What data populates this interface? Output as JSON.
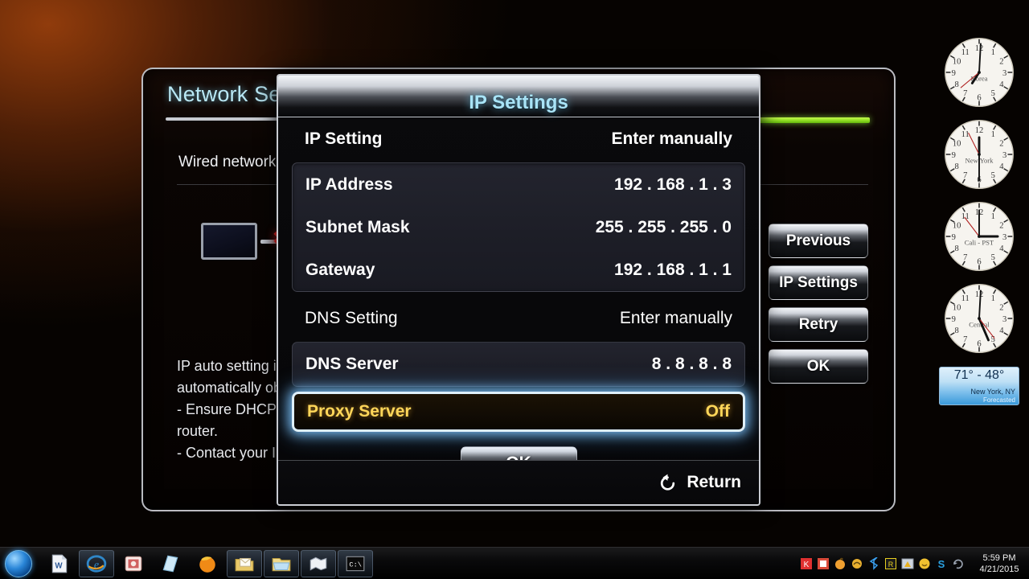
{
  "background_panel": {
    "title": "Network Settings",
    "wired_label": "Wired network connection",
    "help_lines": [
      "IP auto setting is configured",
      "automatically obtain IP values.",
      "- Ensure DHCP server is enabled on",
      "router.",
      "- Contact your Internet provider."
    ],
    "buttons": [
      {
        "label": "Previous",
        "name": "previous-button"
      },
      {
        "label": "IP Settings",
        "name": "ip-settings-button"
      },
      {
        "label": "Retry",
        "name": "retry-button"
      },
      {
        "label": "OK",
        "name": "ok-button-side"
      }
    ],
    "accent_green": "#8ede22",
    "title_color": "#b9e8f5"
  },
  "dialog": {
    "title": "IP Settings",
    "title_color": "#a9e4f7",
    "highlight_border": "#dff0fb",
    "highlight_text": "#ffd659",
    "rows": [
      {
        "label": "IP Setting",
        "value": "Enter manually",
        "group": "top",
        "weight": "bold"
      },
      {
        "label": "IP Address",
        "value": "192 . 168 . 1 . 3",
        "group": "ip",
        "weight": "bold"
      },
      {
        "label": "Subnet Mask",
        "value": "255 . 255 . 255 . 0",
        "group": "ip",
        "weight": "bold"
      },
      {
        "label": "Gateway",
        "value": "192 . 168 . 1 . 1",
        "group": "ip",
        "weight": "bold"
      },
      {
        "label": "DNS Setting",
        "value": "Enter manually",
        "group": "dns-setting",
        "weight": "light"
      },
      {
        "label": "DNS Server",
        "value": "8 . 8 . 8 . 8",
        "group": "dns",
        "weight": "bold"
      }
    ],
    "proxy_row": {
      "label": "Proxy Server",
      "value": "Off"
    },
    "ok_label": "OK",
    "return_label": "Return"
  },
  "gadgets": {
    "clocks": [
      {
        "label": "Korea",
        "hour": 6.3,
        "minute": 32,
        "second": 42
      },
      {
        "label": "New York",
        "hour": 5.99,
        "minute": 59,
        "second": 55
      },
      {
        "label": "Cali - PST",
        "hour": 2.99,
        "minute": 59,
        "second": 50
      },
      {
        "label": "Central",
        "hour": 4.9,
        "minute": 28,
        "second": 53
      }
    ],
    "weather": {
      "temperature": "71°  -  48°",
      "city": "New York, NY",
      "status": "Forecasted"
    }
  },
  "taskbar": {
    "start_name": "start-orb",
    "items": [
      {
        "name": "taskbar-word",
        "open": false
      },
      {
        "name": "taskbar-ie",
        "open": true
      },
      {
        "name": "taskbar-photos",
        "open": false
      },
      {
        "name": "taskbar-notepad",
        "open": false
      },
      {
        "name": "taskbar-firefox",
        "open": false
      },
      {
        "name": "taskbar-mail",
        "open": true
      },
      {
        "name": "taskbar-explorer",
        "open": true
      },
      {
        "name": "taskbar-map",
        "open": true
      },
      {
        "name": "taskbar-cmd",
        "open": true
      }
    ],
    "tray_icons": [
      "tray-antivirus-icon",
      "tray-updates-icon",
      "tray-sound-icon",
      "tray-network-icon",
      "tray-bluetooth-icon",
      "tray-app-icon",
      "tray-warning-icon",
      "tray-chat-icon",
      "tray-skype-icon",
      "tray-sync-icon"
    ],
    "clock": {
      "time": "5:59 PM",
      "date": "4/21/2015"
    }
  }
}
